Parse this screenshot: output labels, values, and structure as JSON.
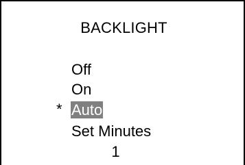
{
  "screen": {
    "title": "BACKLIGHT",
    "selection_marker": "*",
    "items": [
      {
        "label": "Off"
      },
      {
        "label": "On"
      },
      {
        "label": "Auto",
        "selected": true
      },
      {
        "label": "Set Minutes"
      }
    ],
    "minutes_value": "1",
    "colors": {
      "background": "#ffffff",
      "text": "#000000",
      "highlight": "#808080",
      "highlight_text": "#ffffff"
    }
  }
}
